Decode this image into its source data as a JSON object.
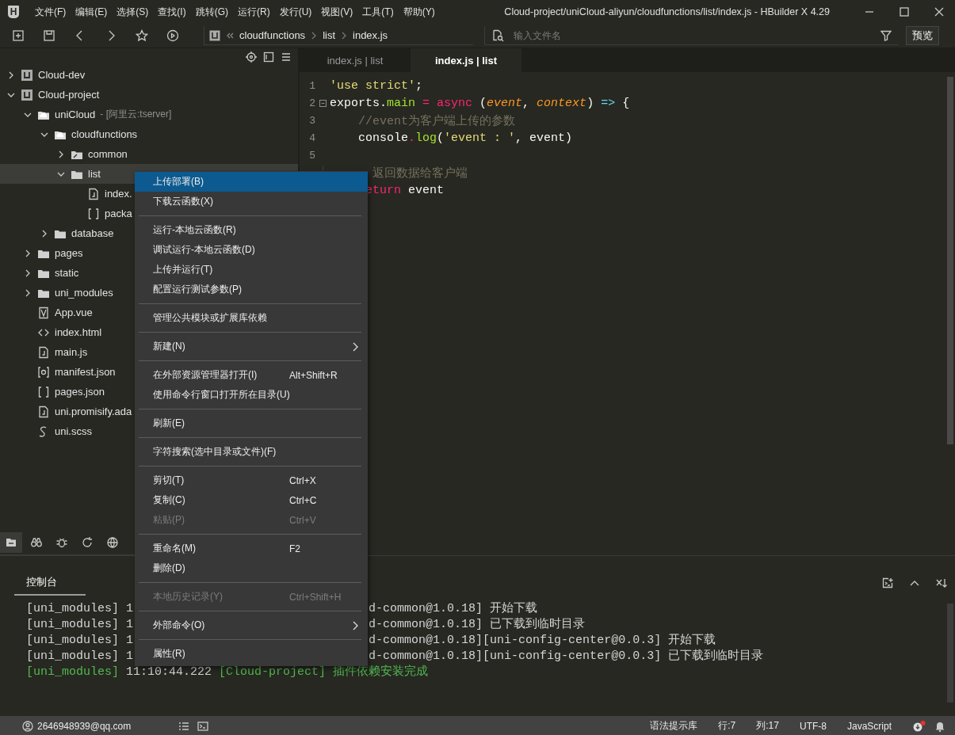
{
  "window": {
    "logo": "H",
    "title": "Cloud-project/uniCloud-aliyun/cloudfunctions/list/index.js - HBuilder X 4.29"
  },
  "menu_bar": [
    "文件(F)",
    "编辑(E)",
    "选择(S)",
    "查找(I)",
    "跳转(G)",
    "运行(R)",
    "发行(U)",
    "视图(V)",
    "工具(T)",
    "帮助(Y)"
  ],
  "breadcrumb": [
    "cloudfunctions",
    "list",
    "index.js"
  ],
  "file_search": {
    "placeholder": "输入文件名"
  },
  "preview_button": "预览",
  "tree": [
    {
      "label": "Cloud-dev",
      "kind": "project",
      "expanded": false,
      "selected": false
    },
    {
      "label": "Cloud-project",
      "kind": "project",
      "expanded": true,
      "selected": false,
      "children": [
        {
          "label": "uniCloud",
          "note": "- [阿里云:tserver]",
          "kind": "cloud",
          "expanded": true,
          "selected": false,
          "children": [
            {
              "label": "cloudfunctions",
              "kind": "cloud",
              "expanded": true,
              "selected": false,
              "children": [
                {
                  "label": "common",
                  "kind": "shared",
                  "expanded": false,
                  "selected": false
                },
                {
                  "label": "list",
                  "kind": "folder",
                  "expanded": true,
                  "selected": true,
                  "children": [
                    {
                      "label": "index.",
                      "kind": "js",
                      "selected": false
                    },
                    {
                      "label": "packa",
                      "kind": "json",
                      "selected": false
                    }
                  ]
                }
              ]
            },
            {
              "label": "database",
              "kind": "folder",
              "expanded": false,
              "selected": false
            }
          ]
        },
        {
          "label": "pages",
          "kind": "folder",
          "expanded": false,
          "selected": false
        },
        {
          "label": "static",
          "kind": "folder",
          "expanded": false,
          "selected": false
        },
        {
          "label": "uni_modules",
          "kind": "folder",
          "expanded": false,
          "selected": false
        },
        {
          "label": "App.vue",
          "kind": "vue",
          "selected": false
        },
        {
          "label": "index.html",
          "kind": "html",
          "selected": false
        },
        {
          "label": "main.js",
          "kind": "js",
          "selected": false
        },
        {
          "label": "manifest.json",
          "kind": "manifest",
          "selected": false
        },
        {
          "label": "pages.json",
          "kind": "json",
          "selected": false
        },
        {
          "label": "uni.promisify.ada",
          "kind": "js",
          "selected": false
        },
        {
          "label": "uni.scss",
          "kind": "style",
          "selected": false
        }
      ]
    }
  ],
  "editor_tabs": [
    {
      "label": "index.js | list",
      "selected": false
    },
    {
      "label": "index.js | list",
      "selected": true
    }
  ],
  "code_lines": [
    {
      "number": "1",
      "foldable": false,
      "tokens": [
        {
          "kind": "string",
          "text": "'use strict'"
        },
        {
          "kind": "plain",
          "text": ";"
        }
      ]
    },
    {
      "number": "2",
      "foldable": true,
      "tokens": [
        {
          "kind": "plain",
          "text": "exports"
        },
        {
          "kind": "plain",
          "text": "."
        },
        {
          "kind": "function",
          "text": "main"
        },
        {
          "kind": "keyword",
          "text": " = async "
        },
        {
          "kind": "plain",
          "text": "("
        },
        {
          "kind": "param",
          "text": "event"
        },
        {
          "kind": "plain",
          "text": ", "
        },
        {
          "kind": "param",
          "text": "context"
        },
        {
          "kind": "plain",
          "text": ") "
        },
        {
          "kind": "arrow",
          "text": "=>"
        },
        {
          "kind": "plain",
          "text": " {"
        }
      ]
    },
    {
      "number": "3",
      "foldable": false,
      "tokens": [
        {
          "kind": "comment",
          "text": "    //event为客户端上传的参数"
        }
      ]
    },
    {
      "number": "4",
      "foldable": false,
      "tokens": [
        {
          "kind": "plain",
          "text": "    console"
        },
        {
          "kind": "keyword",
          "text": "."
        },
        {
          "kind": "function",
          "text": "log"
        },
        {
          "kind": "plain",
          "text": "("
        },
        {
          "kind": "string",
          "text": "'event : '"
        },
        {
          "kind": "plain",
          "text": ", event)"
        }
      ]
    },
    {
      "number": "5",
      "foldable": false
    },
    {
      "tokens": [
        {
          "kind": "comment",
          "text": "      返回数据给客户端"
        }
      ]
    },
    {
      "tokens": [
        {
          "kind": "keyword",
          "text": "     eturn"
        },
        {
          "kind": "plain",
          "text": " event"
        }
      ]
    }
  ],
  "context_menu": [
    {
      "kind": "command",
      "label": "上传部署(B)",
      "selected": true,
      "disabled": false,
      "submenu": false
    },
    {
      "kind": "command",
      "label": "下载云函数(X)",
      "selected": false,
      "disabled": false,
      "submenu": false
    },
    {
      "kind": "separator"
    },
    {
      "kind": "command",
      "label": "运行-本地云函数(R)",
      "selected": false,
      "disabled": false,
      "submenu": false
    },
    {
      "kind": "command",
      "label": "调试运行-本地云函数(D)",
      "selected": false,
      "disabled": false,
      "submenu": false
    },
    {
      "kind": "command",
      "label": "上传并运行(T)",
      "selected": false,
      "disabled": false,
      "submenu": false
    },
    {
      "kind": "command",
      "label": "配置运行测试参数(P)",
      "selected": false,
      "disabled": false,
      "submenu": false
    },
    {
      "kind": "separator"
    },
    {
      "kind": "command",
      "label": "管理公共模块或扩展库依赖",
      "selected": false,
      "disabled": false,
      "submenu": false
    },
    {
      "kind": "separator"
    },
    {
      "kind": "command",
      "label": "新建(N)",
      "selected": false,
      "disabled": false,
      "submenu": true
    },
    {
      "kind": "separator"
    },
    {
      "kind": "command",
      "label": "在外部资源管理器打开(I)",
      "shortcut": "Alt+Shift+R",
      "selected": false,
      "disabled": false,
      "submenu": false
    },
    {
      "kind": "command",
      "label": "使用命令行窗口打开所在目录(U)",
      "selected": false,
      "disabled": false,
      "submenu": false
    },
    {
      "kind": "separator"
    },
    {
      "kind": "command",
      "label": "刷新(E)",
      "selected": false,
      "disabled": false,
      "submenu": false
    },
    {
      "kind": "separator"
    },
    {
      "kind": "command",
      "label": "字符搜索(选中目录或文件)(F)",
      "selected": false,
      "disabled": false,
      "submenu": false
    },
    {
      "kind": "separator"
    },
    {
      "kind": "command",
      "label": "剪切(T)",
      "shortcut": "Ctrl+X",
      "selected": false,
      "disabled": false,
      "submenu": false
    },
    {
      "kind": "command",
      "label": "复制(C)",
      "shortcut": "Ctrl+C",
      "selected": false,
      "disabled": false,
      "submenu": false
    },
    {
      "kind": "command",
      "label": "粘贴(P)",
      "shortcut": "Ctrl+V",
      "selected": false,
      "disabled": true,
      "submenu": false
    },
    {
      "kind": "separator"
    },
    {
      "kind": "command",
      "label": "重命名(M)",
      "shortcut": "F2",
      "selected": false,
      "disabled": false,
      "submenu": false
    },
    {
      "kind": "command",
      "label": "删除(D)",
      "selected": false,
      "disabled": false,
      "submenu": false
    },
    {
      "kind": "separator"
    },
    {
      "kind": "command",
      "label": "本地历史记录(Y)",
      "shortcut": "Ctrl+Shift+H",
      "selected": false,
      "disabled": true,
      "submenu": false
    },
    {
      "kind": "separator"
    },
    {
      "kind": "command",
      "label": "外部命令(O)",
      "selected": false,
      "disabled": false,
      "submenu": true
    },
    {
      "kind": "separator"
    },
    {
      "kind": "command",
      "label": "属性(R)",
      "selected": false,
      "disabled": false,
      "submenu": false
    }
  ],
  "console": {
    "tab": "控制台",
    "lines": [
      {
        "kind": "split",
        "start": "[uni_modules] 1",
        "end": "d-common@1.0.18] 开始下载"
      },
      {
        "kind": "split",
        "start": "[uni_modules] 1",
        "end": "d-common@1.0.18] 已下载到临时目录"
      },
      {
        "kind": "split",
        "start": "[uni_modules] 1",
        "end": "d-common@1.0.18][uni-config-center@0.0.3] 开始下载"
      },
      {
        "kind": "split",
        "start": "[uni_modules] 1",
        "end": "d-common@1.0.18][uni-config-center@0.0.3] 已下载到临时目录"
      },
      {
        "kind": "full",
        "segments": [
          {
            "kind": "success",
            "text": "[uni_modules]"
          },
          {
            "kind": "normal",
            "text": " 11:10:44.222 "
          },
          {
            "kind": "success",
            "text": "[Cloud-project] 插件依赖安装完成"
          }
        ]
      }
    ]
  },
  "status_bar": {
    "account": "2646948939@qq.com",
    "items": [
      "语法提示库",
      "行:7",
      "列:17",
      "UTF-8",
      "JavaScript"
    ]
  }
}
